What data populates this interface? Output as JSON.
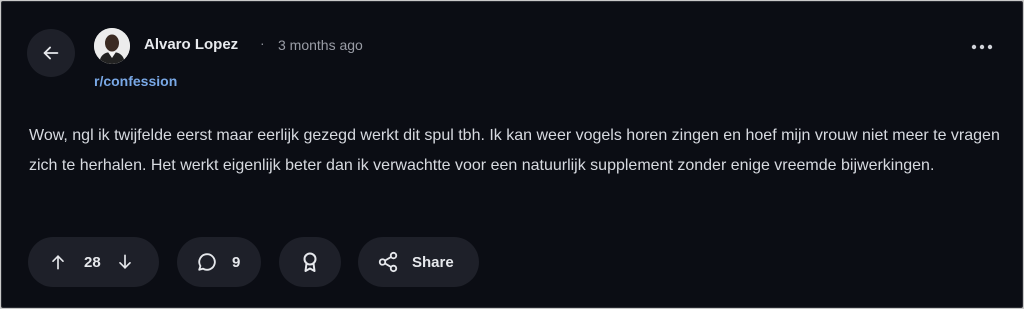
{
  "post": {
    "author": "Alvaro Lopez",
    "separator": "·",
    "time": "3 months ago",
    "subreddit": "r/confession",
    "body": "Wow, ngl ik twijfelde eerst maar eerlijk gezegd werkt dit spul tbh. Ik kan weer vogels horen zingen en hoef mijn vrouw niet meer te vragen zich te herhalen. Het werkt eigenlijk beter dan ik verwachtte voor een natuurlijk supplement zonder enige vreemde bijwerkingen."
  },
  "actions": {
    "votes": "28",
    "comments": "9",
    "share_label": "Share"
  },
  "icons": {
    "back": "arrow-left-icon",
    "more": "more-horizontal-icon",
    "upvote": "arrow-up-icon",
    "downvote": "arrow-down-icon",
    "comment": "comment-bubble-icon",
    "award": "award-icon",
    "share": "share-icon"
  },
  "colors": {
    "background": "#0b0d14",
    "pill": "#1e2029",
    "subreddit_link": "#79a8e6",
    "text": "#d7dae0"
  }
}
